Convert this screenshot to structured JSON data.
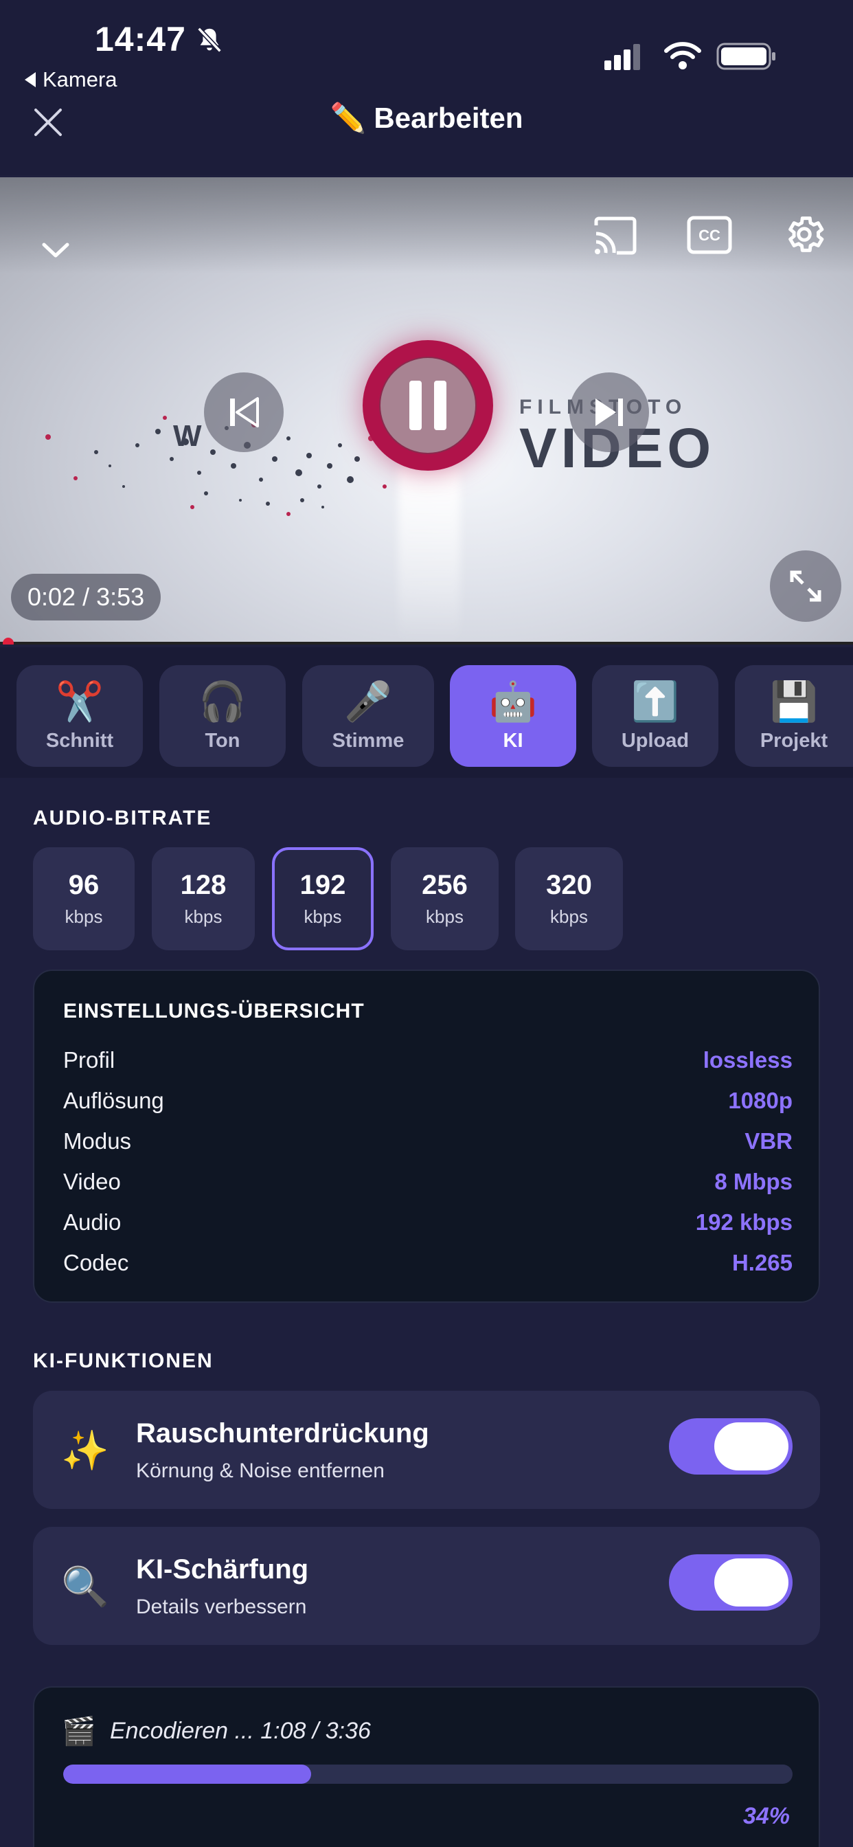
{
  "status_bar": {
    "time": "14:47",
    "back_app": "Kamera"
  },
  "header": {
    "title": "✏️ Bearbeiten"
  },
  "video": {
    "logo_top": "FILMSTOTO",
    "logo_main": "VIDEO",
    "logo_left": "W",
    "time": "0:02 / 3:53"
  },
  "tabs": [
    {
      "icon": "✂️",
      "label": "Schnitt",
      "active": false
    },
    {
      "icon": "🎧",
      "label": "Ton",
      "active": false
    },
    {
      "icon": "🎤",
      "label": "Stimme",
      "active": false
    },
    {
      "icon": "🤖",
      "label": "KI",
      "active": true
    },
    {
      "icon": "⬆️",
      "label": "Upload",
      "active": false
    },
    {
      "icon": "💾",
      "label": "Projekt",
      "active": false
    }
  ],
  "audio_bitrate": {
    "title": "AUDIO-BITRATE",
    "options": [
      {
        "value": "96",
        "unit": "kbps"
      },
      {
        "value": "128",
        "unit": "kbps"
      },
      {
        "value": "192",
        "unit": "kbps"
      },
      {
        "value": "256",
        "unit": "kbps"
      },
      {
        "value": "320",
        "unit": "kbps"
      }
    ],
    "selected": "192"
  },
  "summary": {
    "title": "EINSTELLUNGS-ÜBERSICHT",
    "rows": [
      {
        "key": "Profil",
        "value": "lossless"
      },
      {
        "key": "Auflösung",
        "value": "1080p"
      },
      {
        "key": "Modus",
        "value": "VBR"
      },
      {
        "key": "Video",
        "value": "8 Mbps"
      },
      {
        "key": "Audio",
        "value": "192 kbps"
      },
      {
        "key": "Codec",
        "value": "H.265"
      }
    ]
  },
  "ai": {
    "title": "KI-FUNKTIONEN",
    "features": [
      {
        "icon": "✨",
        "title": "Rauschunterdrückung",
        "subtitle": "Körnung & Noise entfernen",
        "enabled": true
      },
      {
        "icon": "🔍",
        "title": "KI-Schärfung",
        "subtitle": "Details verbessern",
        "enabled": true
      }
    ]
  },
  "encoding": {
    "icon": "🎬",
    "text": "Encodieren ... 1:08 / 3:36",
    "percent_label": "34%",
    "progress": 0.34
  },
  "colors": {
    "accent": "#7b63f0",
    "accent_text": "#8d73ff",
    "background": "#1e1f3d",
    "card": "#2a2b4d",
    "dark_card": "#0f1624"
  }
}
